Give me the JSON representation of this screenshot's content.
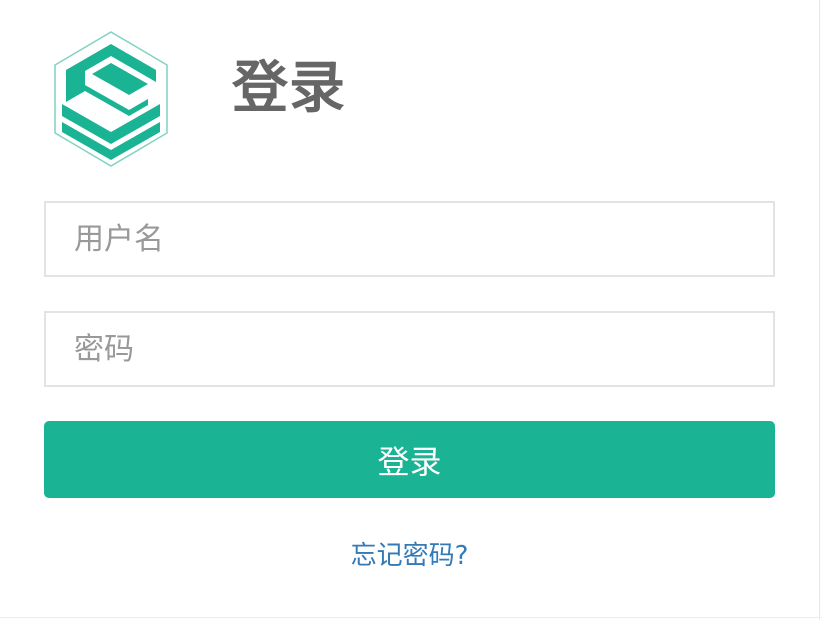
{
  "app": {
    "logo_icon": "hexagon-stack-logo",
    "brand_color": "#1ab394"
  },
  "header": {
    "title": "登录"
  },
  "form": {
    "username_placeholder": "用户名",
    "password_placeholder": "密码",
    "submit_label": "登录",
    "forgot_link": "忘记密码?"
  },
  "colors": {
    "accent": "#1ab394",
    "link": "#337ab7",
    "title": "#666666",
    "border": "#e3e3e3"
  }
}
